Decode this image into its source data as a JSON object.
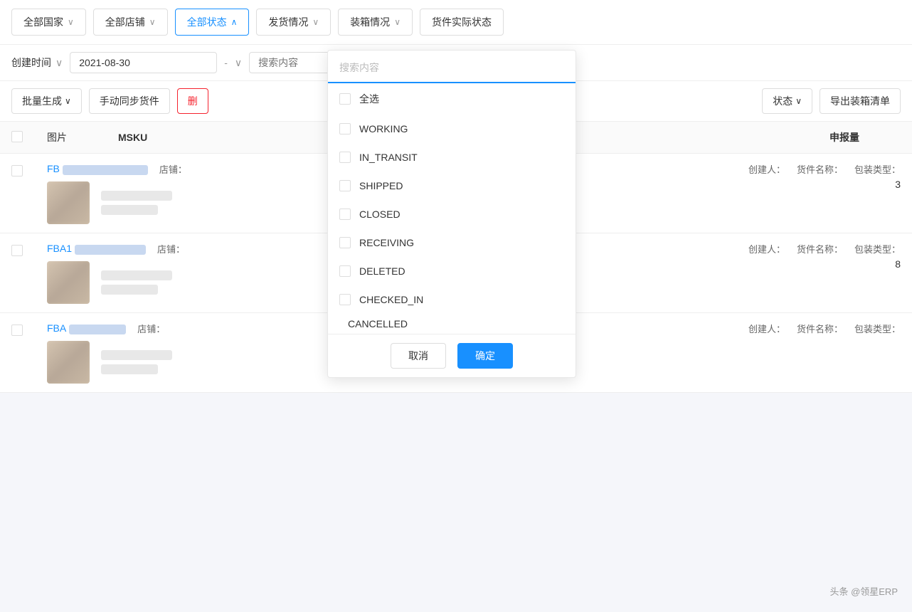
{
  "filterBar1": {
    "btn_country": "全部国家",
    "btn_store": "全部店铺",
    "btn_status": "全部状态",
    "btn_ship": "发货情况",
    "btn_pack": "装箱情况",
    "btn_actual": "货件实际状态"
  },
  "filterBar2": {
    "date_label": "创建时间",
    "date_value": "2021-08-30",
    "date_separator": "-",
    "search_placeholder1": "搜索内容",
    "search_placeholder2": "搜索内容"
  },
  "actionBar": {
    "btn_batch": "批量生成",
    "btn_sync": "手动同步货件",
    "btn_export": "导出装箱清单"
  },
  "tableHeader": {
    "col_check": "",
    "col_img": "图片",
    "col_msku": "MSKU",
    "col_declare": "申报量"
  },
  "tableRows": [
    {
      "id": "FB",
      "store_label": "店铺：",
      "creator_label": "创建人：",
      "goods_label": "货件名称：",
      "pack_label": "包装类型：",
      "declare_qty": "3"
    },
    {
      "id": "FBA1",
      "store_label": "店铺：",
      "creator_label": "创建人：",
      "goods_label": "货件名称：",
      "pack_label": "包装类型：",
      "declare_qty": "8"
    },
    {
      "id": "FBA",
      "store_label": "店铺：",
      "creator_label": "创建人：",
      "goods_label": "货件名称：",
      "pack_label": "包装类型：",
      "declare_qty": ""
    }
  ],
  "dropdown": {
    "search_placeholder": "搜索内容",
    "select_all_label": "全选",
    "items": [
      {
        "label": "WORKING",
        "checked": false
      },
      {
        "label": "IN_TRANSIT",
        "checked": false
      },
      {
        "label": "SHIPPED",
        "checked": false
      },
      {
        "label": "CLOSED",
        "checked": false
      },
      {
        "label": "RECEIVING",
        "checked": false
      },
      {
        "label": "DELETED",
        "checked": false
      },
      {
        "label": "CHECKED_IN",
        "checked": false
      },
      {
        "label": "CANCELLED",
        "checked": false
      }
    ],
    "btn_cancel": "取消",
    "btn_confirm": "确定"
  },
  "watermark": "头条 @领星ERP"
}
